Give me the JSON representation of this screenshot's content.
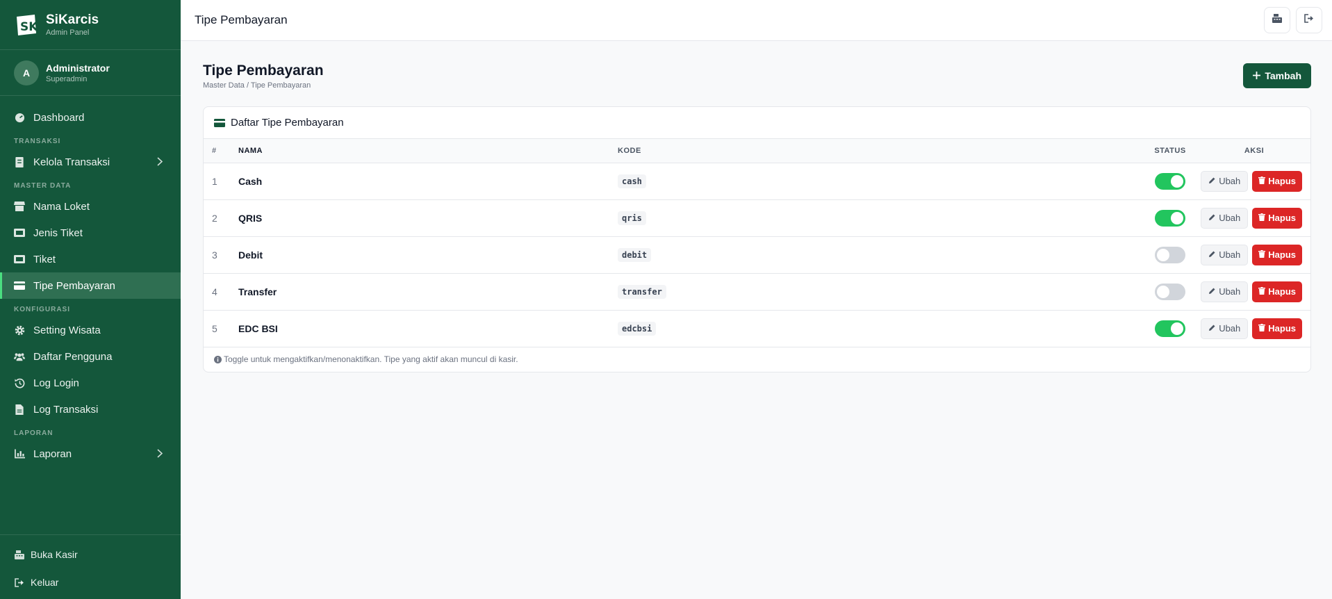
{
  "app": {
    "name": "SiKarcis",
    "subtitle": "Admin Panel"
  },
  "user": {
    "initial": "A",
    "name": "Administrator",
    "role": "Superadmin"
  },
  "nav": {
    "dashboard": "Dashboard",
    "section_transaksi": "TRANSAKSI",
    "kelola_transaksi": "Kelola Transaksi",
    "section_master": "MASTER DATA",
    "nama_loket": "Nama Loket",
    "jenis_tiket": "Jenis Tiket",
    "tiket": "Tiket",
    "tipe_pembayaran": "Tipe Pembayaran",
    "section_konfigurasi": "KONFIGURASI",
    "setting_wisata": "Setting Wisata",
    "daftar_pengguna": "Daftar Pengguna",
    "log_login": "Log Login",
    "log_transaksi": "Log Transaksi",
    "section_laporan": "LAPORAN",
    "laporan": "Laporan"
  },
  "sidebar_bottom": {
    "buka_kasir": "Buka Kasir",
    "keluar": "Keluar"
  },
  "topbar": {
    "title": "Tipe Pembayaran"
  },
  "page": {
    "title": "Tipe Pembayaran",
    "breadcrumb": "Master Data / Tipe Pembayaran",
    "add_button": "Tambah"
  },
  "card": {
    "title": "Daftar Tipe Pembayaran",
    "columns": {
      "num": "#",
      "name": "NAMA",
      "code": "KODE",
      "status": "STATUS",
      "actions": "AKSI"
    },
    "rows": [
      {
        "num": "1",
        "name": "Cash",
        "code": "cash",
        "active": true
      },
      {
        "num": "2",
        "name": "QRIS",
        "code": "qris",
        "active": true
      },
      {
        "num": "3",
        "name": "Debit",
        "code": "debit",
        "active": false
      },
      {
        "num": "4",
        "name": "Transfer",
        "code": "transfer",
        "active": false
      },
      {
        "num": "5",
        "name": "EDC BSI",
        "code": "edcbsi",
        "active": true
      }
    ],
    "edit_label": "Ubah",
    "delete_label": "Hapus",
    "footer_note": "Toggle untuk mengaktifkan/menonaktifkan. Tipe yang aktif akan muncul di kasir."
  },
  "colors": {
    "sidebar": "#14573b",
    "toggle_on": "#22c55e",
    "danger": "#dc2626"
  },
  "icons": [
    "app-logo",
    "dashboard-icon",
    "receipt-icon",
    "store-icon",
    "ticket-icon",
    "credit-card-icon",
    "gear-icon",
    "users-icon",
    "history-icon",
    "file-icon",
    "chart-icon",
    "cash-register-icon",
    "sign-out-icon",
    "plus-icon",
    "pencil-icon",
    "trash-icon",
    "info-icon"
  ]
}
